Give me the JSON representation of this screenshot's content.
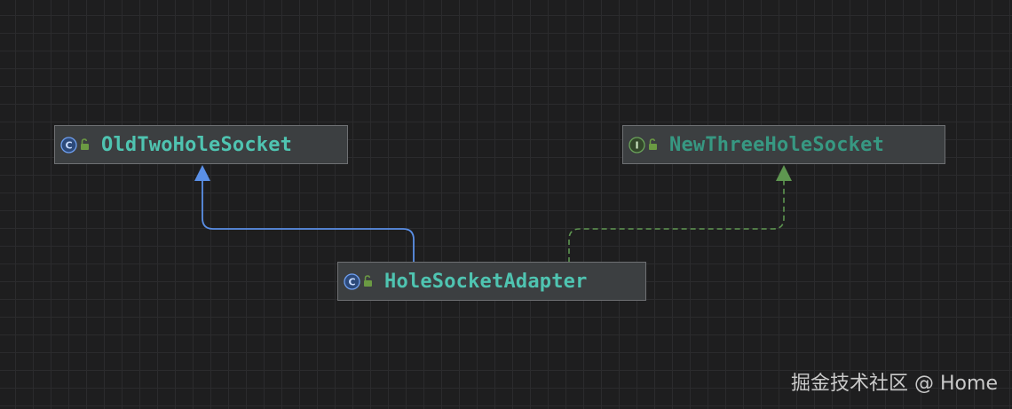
{
  "nodes": {
    "old_two_hole_socket": {
      "label": "OldTwoHoleSocket",
      "kind": "class-icon",
      "visibility": "public-unlocked-icon"
    },
    "new_three_hole_socket": {
      "label": "NewThreeHoleSocket",
      "kind": "interface-icon",
      "visibility": "public-unlocked-icon"
    },
    "hole_socket_adapter": {
      "label": "HoleSocketAdapter",
      "kind": "class-icon",
      "visibility": "public-unlocked-icon"
    }
  },
  "edges": [
    {
      "from": "HoleSocketAdapter",
      "to": "OldTwoHoleSocket",
      "relation": "extends",
      "style": "solid",
      "color": "#5a8fe6"
    },
    {
      "from": "HoleSocketAdapter",
      "to": "NewThreeHoleSocket",
      "relation": "implements",
      "style": "dashed",
      "color": "#5e9650"
    }
  ],
  "colors": {
    "class_text": "#4fc4b1",
    "interface_text": "#379882",
    "class_icon": "#4a7fd4",
    "interface_icon": "#5e9650",
    "lock": "#6b9a43"
  },
  "watermark": "掘金技术社区 @ Home"
}
